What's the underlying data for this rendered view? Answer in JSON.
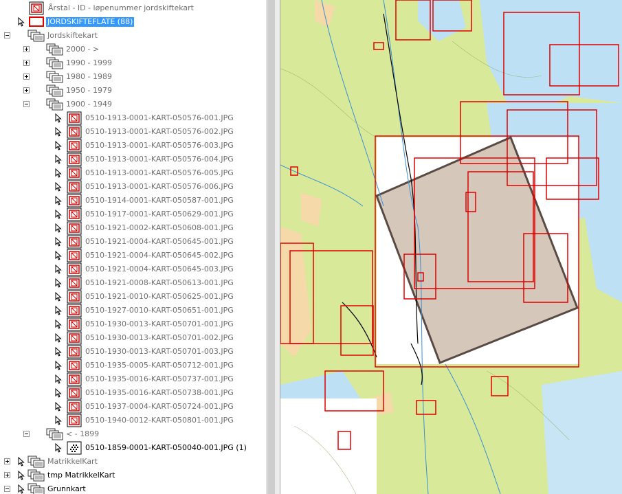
{
  "tree": {
    "top_layer_label": "Årstal - ID - løpenummer jordskiftekart",
    "selected_layer_label": "JORDSKIFTEFLATE (88)",
    "group_label": "Jordskiftekart",
    "subgroups": [
      {
        "label": "2000 - >",
        "expanded": false
      },
      {
        "label": "1990 - 1999",
        "expanded": false
      },
      {
        "label": "1980 - 1989",
        "expanded": false
      },
      {
        "label": "1950 - 1979",
        "expanded": false
      },
      {
        "label": "1900 - 1949",
        "expanded": true
      }
    ],
    "raster_items": [
      "0510-1913-0001-KART-050576-001.JPG",
      "0510-1913-0001-KART-050576-002.JPG",
      "0510-1913-0001-KART-050576-003.JPG",
      "0510-1913-0001-KART-050576-004.JPG",
      "0510-1913-0001-KART-050576-005.JPG",
      "0510-1913-0001-KART-050576-006.JPG",
      "0510-1914-0001-KART-050587-001.JPG",
      "0510-1917-0001-KART-050629-001.JPG",
      "0510-1921-0002-KART-050608-001.JPG",
      "0510-1921-0004-KART-050645-001.JPG",
      "0510-1921-0004-KART-050645-002.JPG",
      "0510-1921-0004-KART-050645-003.JPG",
      "0510-1921-0008-KART-050613-001.JPG",
      "0510-1921-0010-KART-050625-001.JPG",
      "0510-1927-0010-KART-050651-001.JPG",
      "0510-1930-0013-KART-050701-001.JPG",
      "0510-1930-0013-KART-050701-002.JPG",
      "0510-1930-0013-KART-050701-003.JPG",
      "0510-1935-0005-KART-050712-001.JPG",
      "0510-1935-0016-KART-050737-001.JPG",
      "0510-1935-0016-KART-050738-001.JPG",
      "0510-1937-0004-KART-050724-001.JPG",
      "0510-1940-0012-KART-050801-001.JPG"
    ],
    "subgroup_old_label": "< - 1899",
    "old_item_label": "0510-1859-0001-KART-050040-001.JPG (1)",
    "bottom_groups": [
      {
        "label": "MatrikkelKart",
        "greyed": true
      },
      {
        "label": "tmp MatrikkelKart",
        "greyed": false
      },
      {
        "label": "Grunnkart",
        "greyed": false
      }
    ]
  },
  "map": {
    "colors": {
      "land": "#d9e99a",
      "water": "#bde0f5",
      "sand": "#f5d9a8",
      "frame": "#e00000",
      "highlight": "#c8b4a4"
    }
  }
}
